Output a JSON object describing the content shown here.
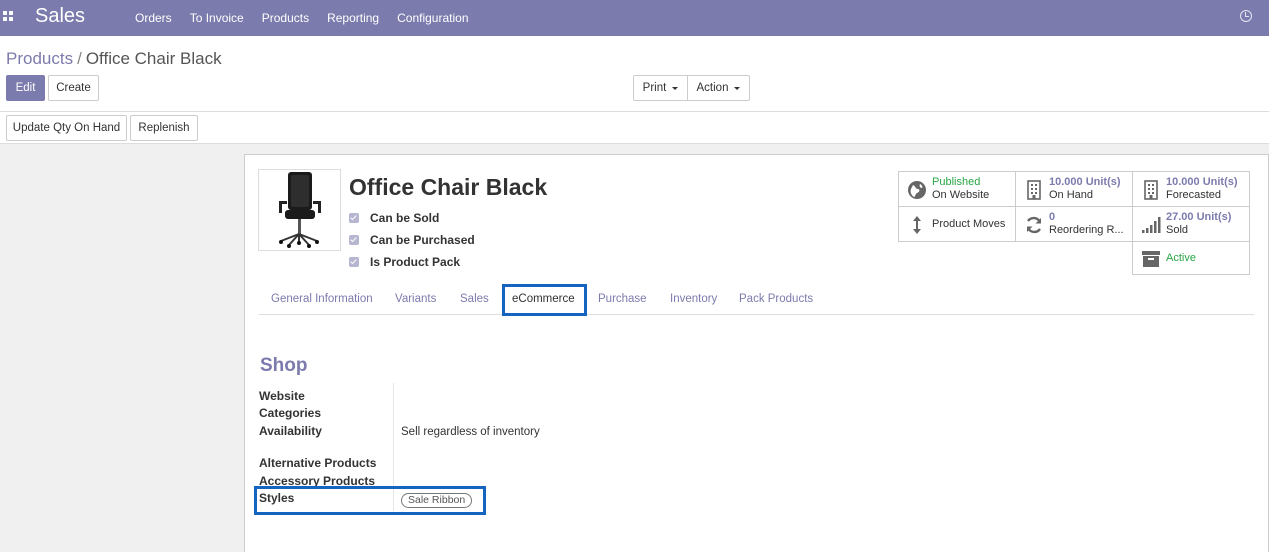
{
  "navbar": {
    "app_name": "Sales",
    "menu": [
      "Orders",
      "To Invoice",
      "Products",
      "Reporting",
      "Configuration"
    ]
  },
  "breadcrumb": {
    "parent": "Products",
    "separator": "/",
    "current": "Office Chair Black"
  },
  "buttons": {
    "edit": "Edit",
    "create": "Create",
    "print": "Print",
    "action": "Action",
    "update_qty": "Update Qty On Hand",
    "replenish": "Replenish"
  },
  "product": {
    "name": "Office Chair Black",
    "flags": [
      "Can be Sold",
      "Can be Purchased",
      "Is Product Pack"
    ]
  },
  "smart_buttons": {
    "published": {
      "value": "Published",
      "label": "On Website"
    },
    "on_hand": {
      "value": "10.000 Unit(s)",
      "label": "On Hand"
    },
    "forecasted": {
      "value": "10.000 Unit(s)",
      "label": "Forecasted"
    },
    "moves": {
      "label": "Product Moves"
    },
    "reordering": {
      "value": "0",
      "label": "Reordering R..."
    },
    "sold": {
      "value": "27.00 Unit(s)",
      "label": "Sold"
    },
    "active": {
      "value": "Active"
    }
  },
  "tabs": [
    "General Information",
    "Variants",
    "Sales",
    "eCommerce",
    "Purchase",
    "Inventory",
    "Pack Products"
  ],
  "active_tab": "eCommerce",
  "shop": {
    "title": "Shop",
    "labels": {
      "website": "Website",
      "categories": "Categories",
      "availability": "Availability",
      "alternative": "Alternative Products",
      "accessory": "Accessory Products",
      "styles": "Styles"
    },
    "availability_value": "Sell regardless of inventory",
    "style_tag": "Sale Ribbon"
  },
  "colors": {
    "brand": "#7c7bad",
    "highlight": "#1565c0",
    "published": "#28a745"
  }
}
